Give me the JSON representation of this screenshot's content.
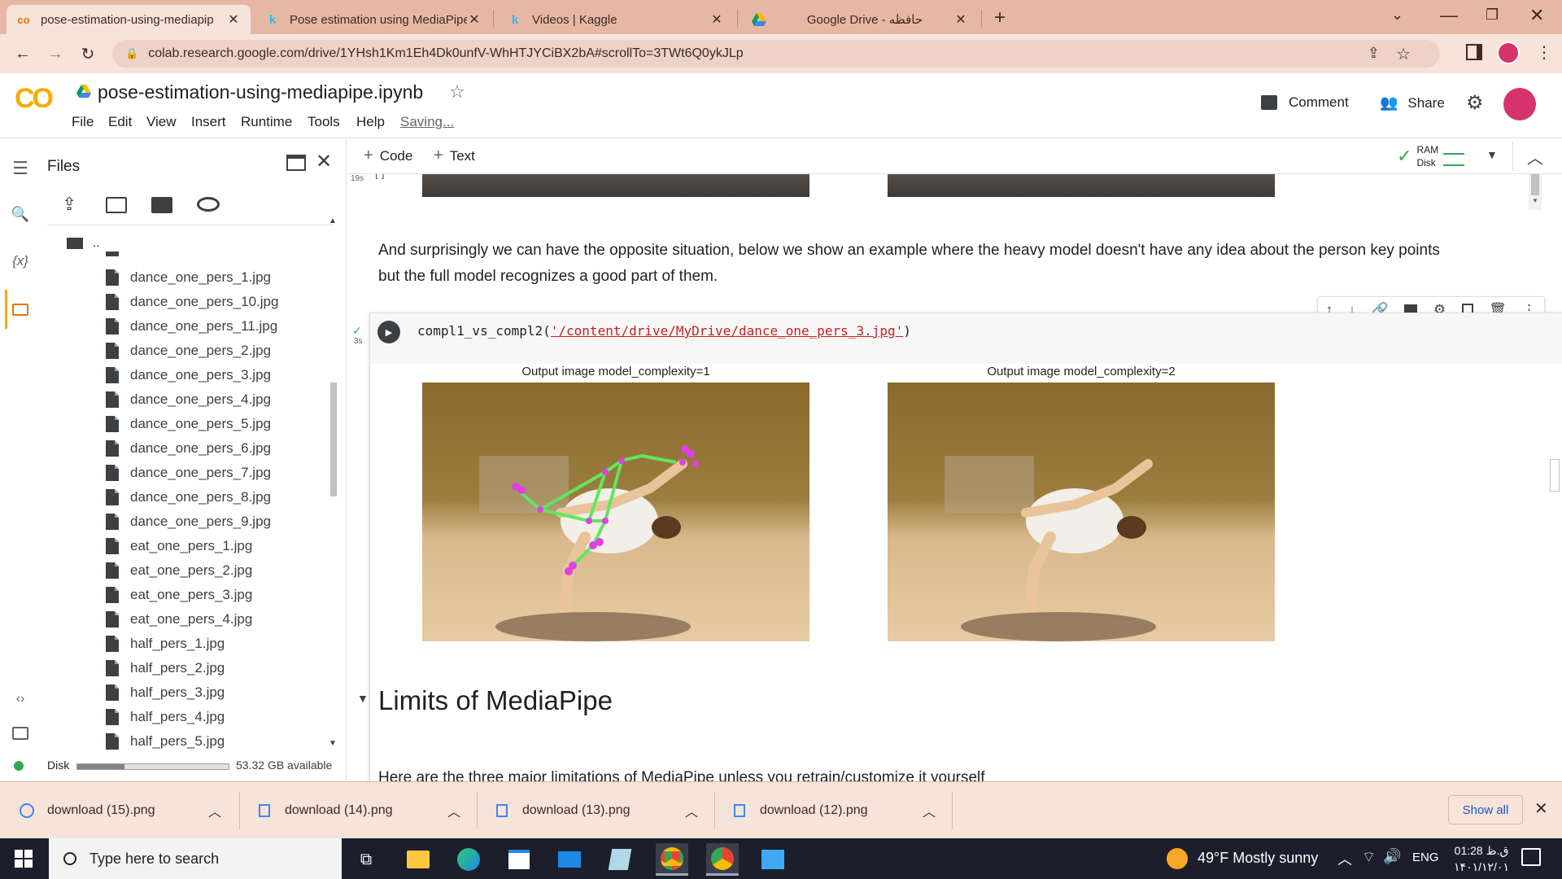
{
  "browser": {
    "tabs": [
      {
        "title": "pose-estimation-using-mediapip",
        "icon": "colab-icon",
        "active": true
      },
      {
        "title": "Pose estimation using MediaPipe",
        "icon": "kaggle-icon",
        "active": false
      },
      {
        "title": "Videos | Kaggle",
        "icon": "kaggle-icon",
        "active": false
      },
      {
        "title": "Google Drive - حافظه",
        "icon": "drive-icon",
        "active": false
      }
    ],
    "url": "colab.research.google.com/drive/1YHsh1Km1Eh4Dk0unfV-WhHTJYCiBX2bA#scrollTo=3TWt6Q0ykJLp"
  },
  "colab": {
    "logo": "CO",
    "notebook_name": "pose-estimation-using-mediapipe.ipynb",
    "menu": [
      "File",
      "Edit",
      "View",
      "Insert",
      "Runtime",
      "Tools",
      "Help"
    ],
    "saving_status": "Saving...",
    "comment_label": "Comment",
    "share_label": "Share"
  },
  "sidebar": {
    "title": "Files",
    "parent_dir": "..",
    "files": [
      "dance_one_pers_1.jpg",
      "dance_one_pers_10.jpg",
      "dance_one_pers_11.jpg",
      "dance_one_pers_2.jpg",
      "dance_one_pers_3.jpg",
      "dance_one_pers_4.jpg",
      "dance_one_pers_5.jpg",
      "dance_one_pers_6.jpg",
      "dance_one_pers_7.jpg",
      "dance_one_pers_8.jpg",
      "dance_one_pers_9.jpg",
      "eat_one_pers_1.jpg",
      "eat_one_pers_2.jpg",
      "eat_one_pers_3.jpg",
      "eat_one_pers_4.jpg",
      "half_pers_1.jpg",
      "half_pers_2.jpg",
      "half_pers_3.jpg",
      "half_pers_4.jpg",
      "half_pers_5.jpg"
    ],
    "disk_label": "Disk",
    "disk_available": "53.32 GB available",
    "disk_used_fraction": 0.31
  },
  "toolbar": {
    "code_label": "Code",
    "text_label": "Text",
    "ram_label": "RAM",
    "disk_label": "Disk"
  },
  "notebook": {
    "prev_exec_time": "19s",
    "prev_bracket": "[ ]",
    "paragraph": "And surprisingly we can have the opposite situation, below we show an example where the heavy model doesn't have any idea about the person key points but the full model recognizes a good part of them.",
    "cell": {
      "exec_time": "3s",
      "code_func": "compl1_vs_compl2(",
      "code_arg": "'/content/drive/MyDrive/dance_one_pers_3.jpg'",
      "code_close": ")"
    },
    "outputs": [
      {
        "title": "Output image model_complexity=1"
      },
      {
        "title": "Output image model_complexity=2"
      }
    ],
    "section_title": "Limits of MediaPipe",
    "next_paragraph": "Here are the three major limitations of MediaPipe unless you retrain/customize it yourself"
  },
  "downloads": {
    "items": [
      "download (15).png",
      "download (14).png",
      "download (13).png",
      "download (12).png"
    ],
    "show_all": "Show all"
  },
  "taskbar": {
    "search_placeholder": "Type here to search",
    "weather": "49°F  Mostly sunny",
    "lang": "ENG",
    "time": "01:28 ق.ظ",
    "date": "۱۴۰۱/۱۲/۰۱"
  },
  "colors": {
    "tab_bg": "#e7b7a6",
    "addr_bg": "#f6e3da",
    "colab_orange": "#f9ab00",
    "link_red": "#c5221f",
    "pose_green": "#5ee85e",
    "pose_magenta": "#e040e0"
  }
}
